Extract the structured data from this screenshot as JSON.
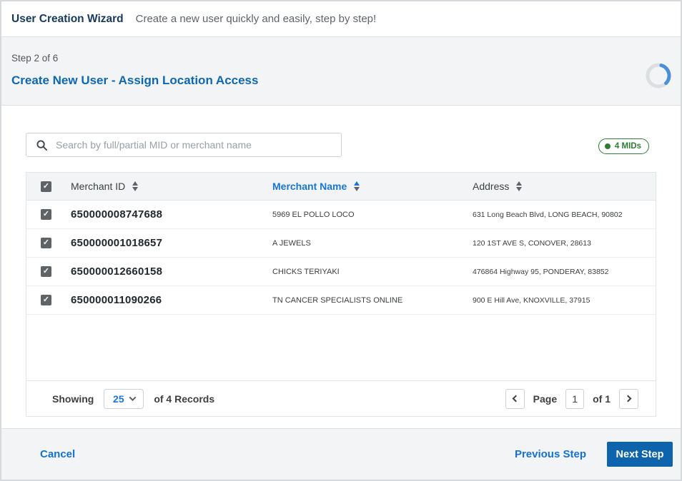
{
  "header": {
    "title": "User Creation Wizard",
    "subtitle": "Create a new user quickly and easily, step by step!"
  },
  "wizard": {
    "step_label": "Step 2 of 6",
    "heading": "Create New User - Assign Location Access",
    "step": 2,
    "total_steps": 6
  },
  "search": {
    "placeholder": "Search by full/partial MID or merchant name",
    "value": ""
  },
  "badge": {
    "label": "4 MIDs"
  },
  "table": {
    "select_all_checked": true,
    "columns": [
      {
        "label": "Merchant ID",
        "sort": "none"
      },
      {
        "label": "Merchant Name",
        "sort": "asc"
      },
      {
        "label": "Address",
        "sort": "none"
      }
    ],
    "rows": [
      {
        "checked": true,
        "merchant_id": "650000008747688",
        "merchant_name": "5969 EL POLLO LOCO",
        "address": "631 Long Beach Blvd, LONG BEACH, 90802"
      },
      {
        "checked": true,
        "merchant_id": "650000001018657",
        "merchant_name": "A JEWELS",
        "address": "120 1ST AVE S, CONOVER, 28613"
      },
      {
        "checked": true,
        "merchant_id": "650000012660158",
        "merchant_name": "CHICKS TERIYAKI",
        "address": "476864 Highway 95, PONDERAY, 83852"
      },
      {
        "checked": true,
        "merchant_id": "650000011090266",
        "merchant_name": "TN CANCER SPECIALISTS ONLINE",
        "address": "900 E Hill Ave, KNOXVILLE, 37915"
      }
    ]
  },
  "pagination": {
    "showing_label": "Showing",
    "page_size": "25",
    "records_label": "of 4 Records",
    "page_label": "Page",
    "current_page": "1",
    "of_label": "of 1"
  },
  "footer": {
    "cancel_label": "Cancel",
    "previous_label": "Previous Step",
    "next_label": "Next Step"
  },
  "icons": {
    "search": "search-icon",
    "checkmark": "✓"
  },
  "colors": {
    "title_navy": "#17395f",
    "heading_blue": "#0e67b2",
    "link_blue": "#1272d4",
    "button_blue": "#0d64ad",
    "sort_active_blue": "#1976d2",
    "badge_green": "#2e7d32",
    "checkbox_gray": "#5f6368",
    "spinner_track": "#dcdfe2",
    "spinner_arc": "#4a90d9"
  }
}
